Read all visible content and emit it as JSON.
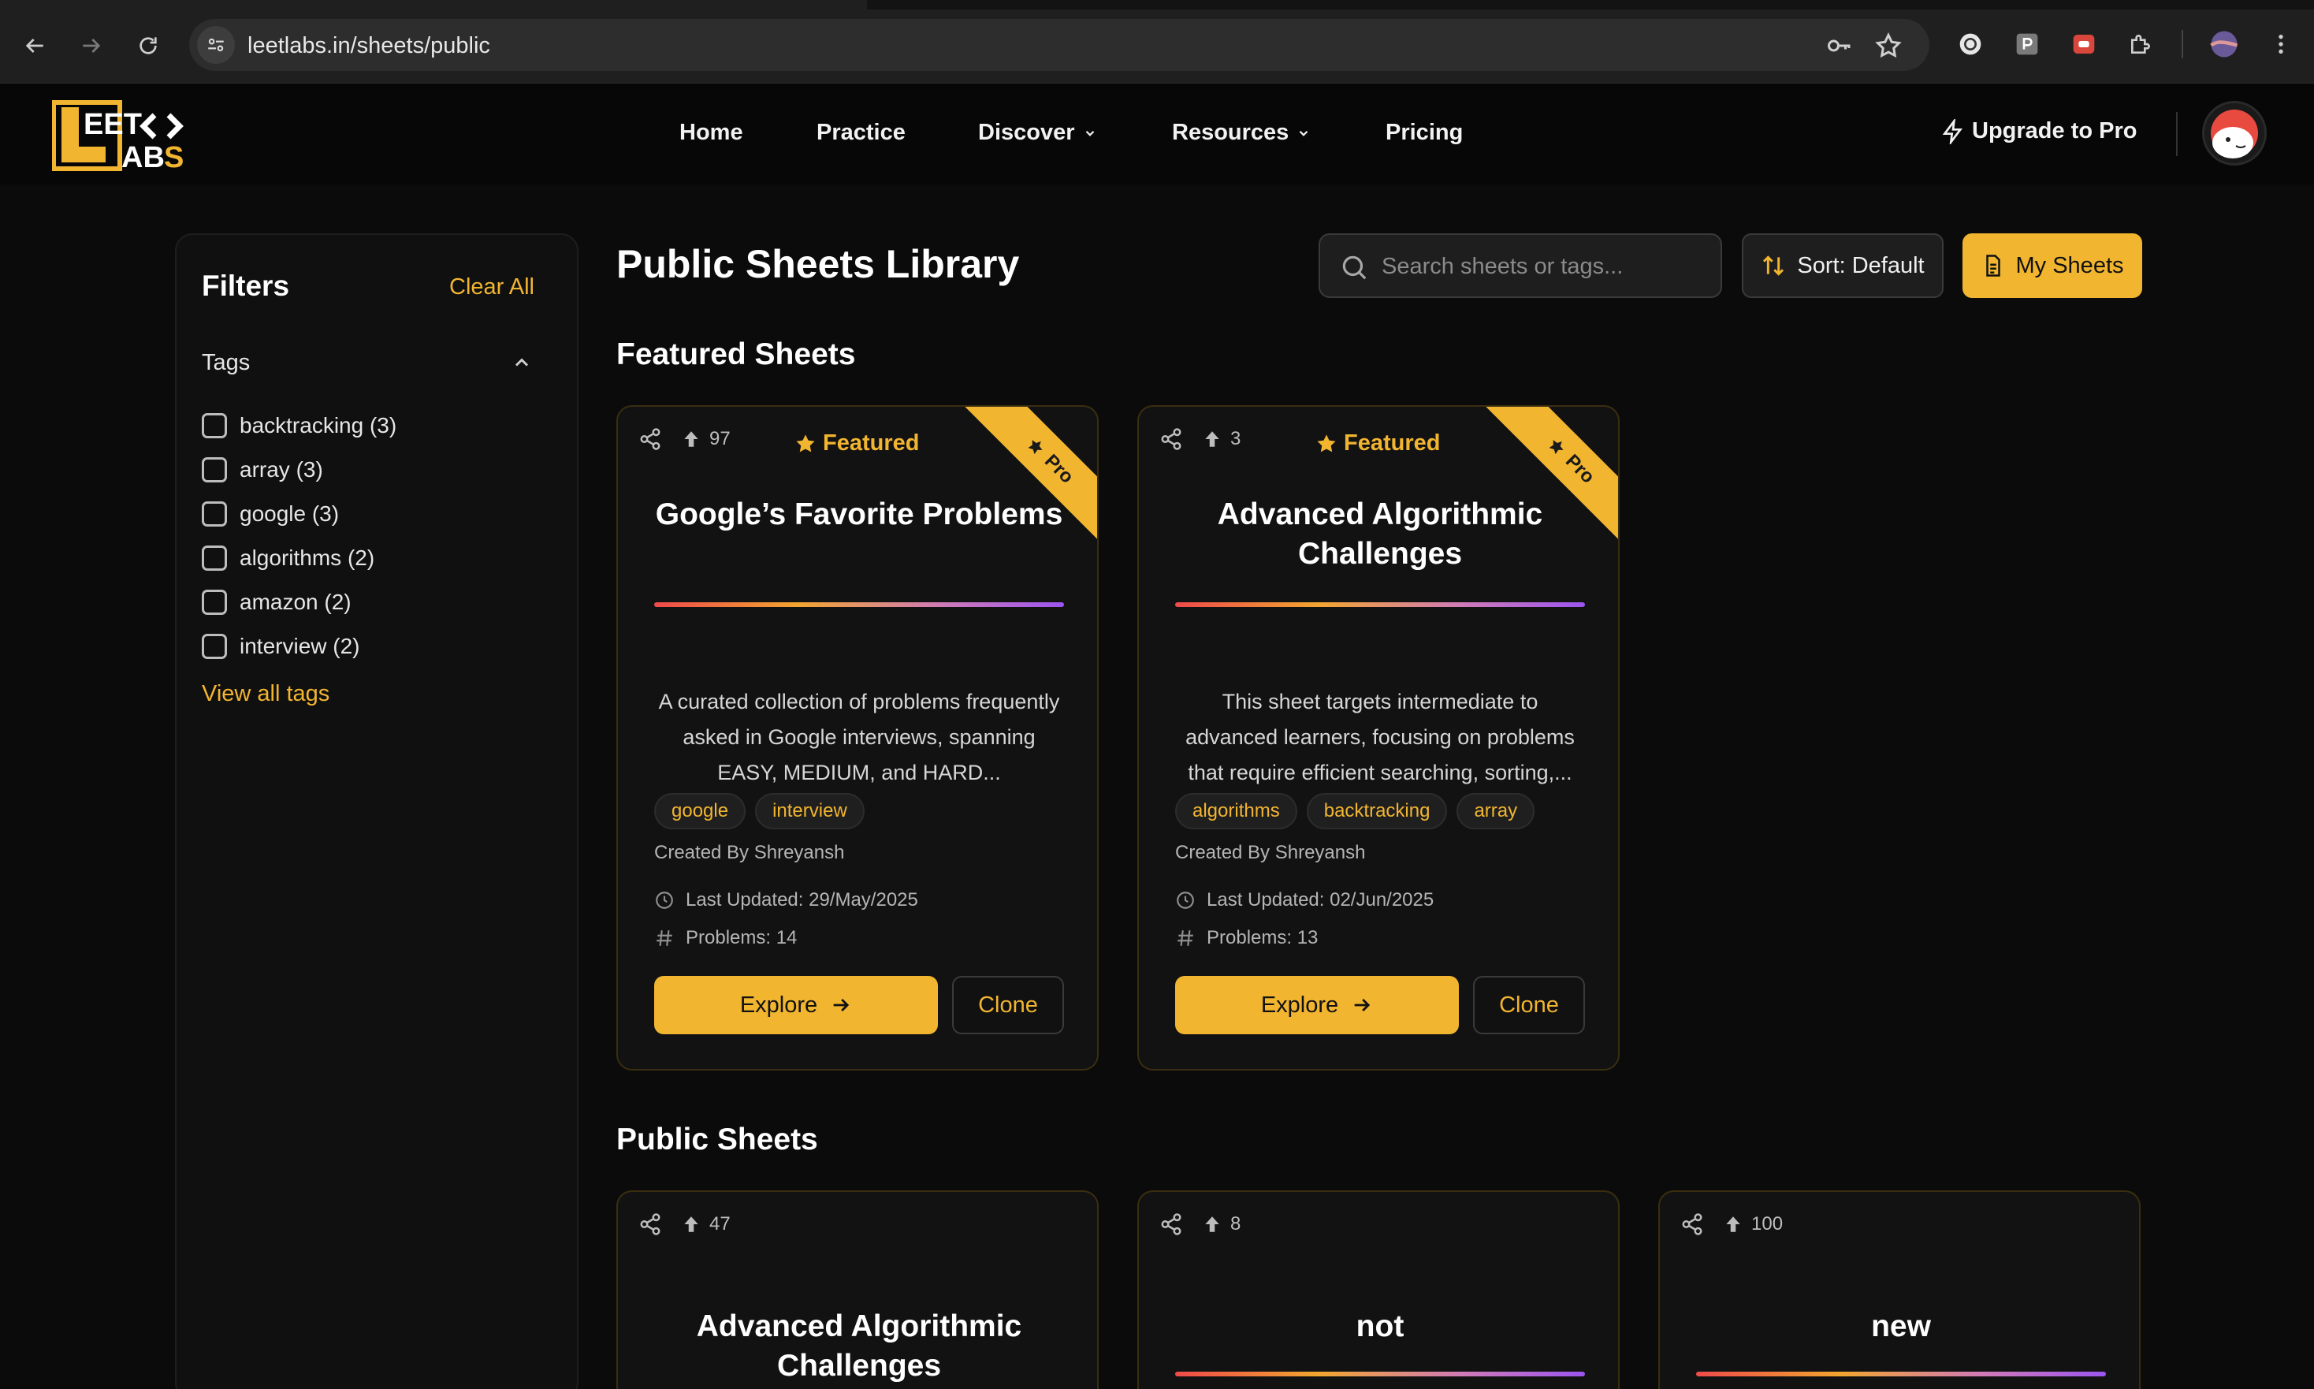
{
  "browser": {
    "url": "leetlabs.in/sheets/public"
  },
  "header": {
    "logo": "LEET<> LABS",
    "nav": [
      {
        "label": "Home",
        "dropdown": false
      },
      {
        "label": "Practice",
        "dropdown": false
      },
      {
        "label": "Discover",
        "dropdown": true
      },
      {
        "label": "Resources",
        "dropdown": true
      },
      {
        "label": "Pricing",
        "dropdown": false
      }
    ],
    "upgrade_label": "Upgrade to Pro"
  },
  "filters": {
    "title": "Filters",
    "clear_label": "Clear All",
    "tags_heading": "Tags",
    "tags": [
      {
        "label": "backtracking (3)",
        "checked": false
      },
      {
        "label": "array (3)",
        "checked": false
      },
      {
        "label": "google (3)",
        "checked": false
      },
      {
        "label": "algorithms (2)",
        "checked": false
      },
      {
        "label": "amazon (2)",
        "checked": false
      },
      {
        "label": "interview (2)",
        "checked": false
      }
    ],
    "view_all_label": "View all tags"
  },
  "main": {
    "title": "Public Sheets Library",
    "search_placeholder": "Search sheets or tags...",
    "sort_label": "Sort: Default",
    "my_sheets_label": "My Sheets",
    "featured_heading": "Featured Sheets",
    "public_heading": "Public Sheets",
    "featured_cards": [
      {
        "upvotes": "97",
        "featured_label": "Featured",
        "ribbon": "Pro",
        "title": "Google’s Favorite Problems",
        "description": "A curated collection of problems frequently asked in Google interviews, spanning EASY, MEDIUM, and HARD...",
        "tags": [
          "google",
          "interview"
        ],
        "creator": "Created By Shreyansh",
        "updated": "Last Updated: 29/May/2025",
        "problems": "Problems: 14",
        "explore_label": "Explore",
        "clone_label": "Clone"
      },
      {
        "upvotes": "3",
        "featured_label": "Featured",
        "ribbon": "Pro",
        "title": "Advanced Algorithmic Challenges",
        "description": "This sheet targets intermediate to advanced learners, focusing on problems that require efficient searching, sorting,...",
        "tags": [
          "algorithms",
          "backtracking",
          "array"
        ],
        "creator": "Created By Shreyansh",
        "updated": "Last Updated: 02/Jun/2025",
        "problems": "Problems: 13",
        "explore_label": "Explore",
        "clone_label": "Clone"
      }
    ],
    "public_cards": [
      {
        "upvotes": "47",
        "title": "Advanced Algorithmic Challenges"
      },
      {
        "upvotes": "8",
        "title": "not"
      },
      {
        "upvotes": "100",
        "title": "new"
      }
    ]
  },
  "colors": {
    "accent": "#f2b530",
    "background": "#0b0b0b",
    "card": "#121212"
  }
}
